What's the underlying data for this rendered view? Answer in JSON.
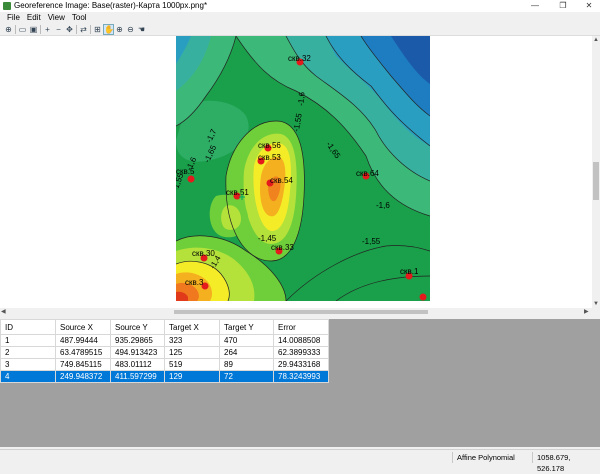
{
  "window": {
    "title": "Georeference Image: Base(raster)-Карта 1000px.png*",
    "minimize": "—",
    "restore": "❐",
    "close": "✕"
  },
  "menu": [
    "File",
    "Edit",
    "View",
    "Tool"
  ],
  "toolbar": [
    "georeference-icon",
    "open-icon",
    "save-icon",
    "add-point-icon",
    "delete-point-icon",
    "move-point-icon",
    "link-icon",
    "pan-icon",
    "zoom-in-icon",
    "zoom-out-icon",
    "zoom-extent-icon",
    "hand-icon"
  ],
  "map": {
    "points": [
      {
        "label": "скв.32"
      },
      {
        "label": "скв.56"
      },
      {
        "label": "скв.53"
      },
      {
        "label": "скв.54"
      },
      {
        "label": "скв.5"
      },
      {
        "label": "скв.51"
      },
      {
        "label": "скв.64"
      },
      {
        "label": "скв.30"
      },
      {
        "label": "скв.33"
      },
      {
        "label": "скв.3"
      },
      {
        "label": "скв.1"
      }
    ],
    "isolines": [
      "-1,55",
      "-1,6",
      "-1,65",
      "-1,7",
      "-1,6",
      "-1,55",
      "-1,65",
      "-1,45",
      "-1,55",
      "-1,6",
      "-1,4"
    ]
  },
  "table": {
    "columns": [
      "ID",
      "Source X",
      "Source Y",
      "Target X",
      "Target Y",
      "Error"
    ],
    "rows": [
      [
        "1",
        "487.99444",
        "935.29865",
        "323",
        "470",
        "14.0088508"
      ],
      [
        "2",
        "63.4789515",
        "494.913423",
        "125",
        "264",
        "62.3899333"
      ],
      [
        "3",
        "749.845115",
        "483.01112",
        "519",
        "89",
        "29.9433168"
      ],
      [
        "4",
        "249.948372",
        "411.597299",
        "129",
        "72",
        "78.3243993"
      ]
    ],
    "selected_row": 3
  },
  "status": {
    "transform": "Affine Polynomial",
    "coords": "1058.679, 526.178"
  },
  "colors": {
    "selection": "#0078d7",
    "marker": "#e41a1c"
  }
}
